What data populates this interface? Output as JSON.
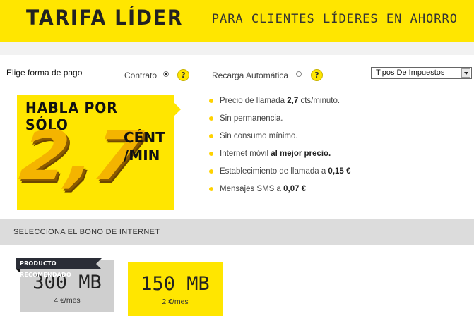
{
  "header": {
    "title": "TARIFA LÍDER",
    "tagline": "PARA CLIENTES LÍDERES EN AHORRO"
  },
  "payment": {
    "label": "Elige forma de pago",
    "options": [
      {
        "label": "Contrato",
        "selected": true
      },
      {
        "label": "Recarga Automática",
        "selected": false
      }
    ],
    "help_icon": "question-icon",
    "help_glyph": "?",
    "tax_select": {
      "value": "Tipos De Impuestos"
    }
  },
  "promo": {
    "headline": "HABLA POR SÓLO",
    "price": "2,7",
    "unit_line1": "CÉNT",
    "unit_line2": "/MIN"
  },
  "features": [
    {
      "text": "Precio de llamada ",
      "bold": "2,7",
      "after": " cts/minuto."
    },
    {
      "text": "Sin permanencia.",
      "bold": "",
      "after": ""
    },
    {
      "text": "Sin consumo mínimo.",
      "bold": "",
      "after": ""
    },
    {
      "text": "Internet móvil ",
      "bold": "al mejor precio.",
      "after": ""
    },
    {
      "text": "Establecimiento de llamada a ",
      "bold": "0,15 €",
      "after": ""
    },
    {
      "text": "Mensajes SMS a ",
      "bold": "0,07 €",
      "after": ""
    }
  ],
  "bono": {
    "title": "SELECCIONA EL BONO DE INTERNET",
    "badge": "PRODUCTO RECOMENDADO",
    "cards": [
      {
        "data": "300 MB",
        "price": "4 €/mes"
      },
      {
        "data": "150 MB",
        "price": "2 €/mes"
      }
    ]
  },
  "colors": {
    "brand_yellow": "#ffe600",
    "badge_dark": "#2a2d36"
  }
}
